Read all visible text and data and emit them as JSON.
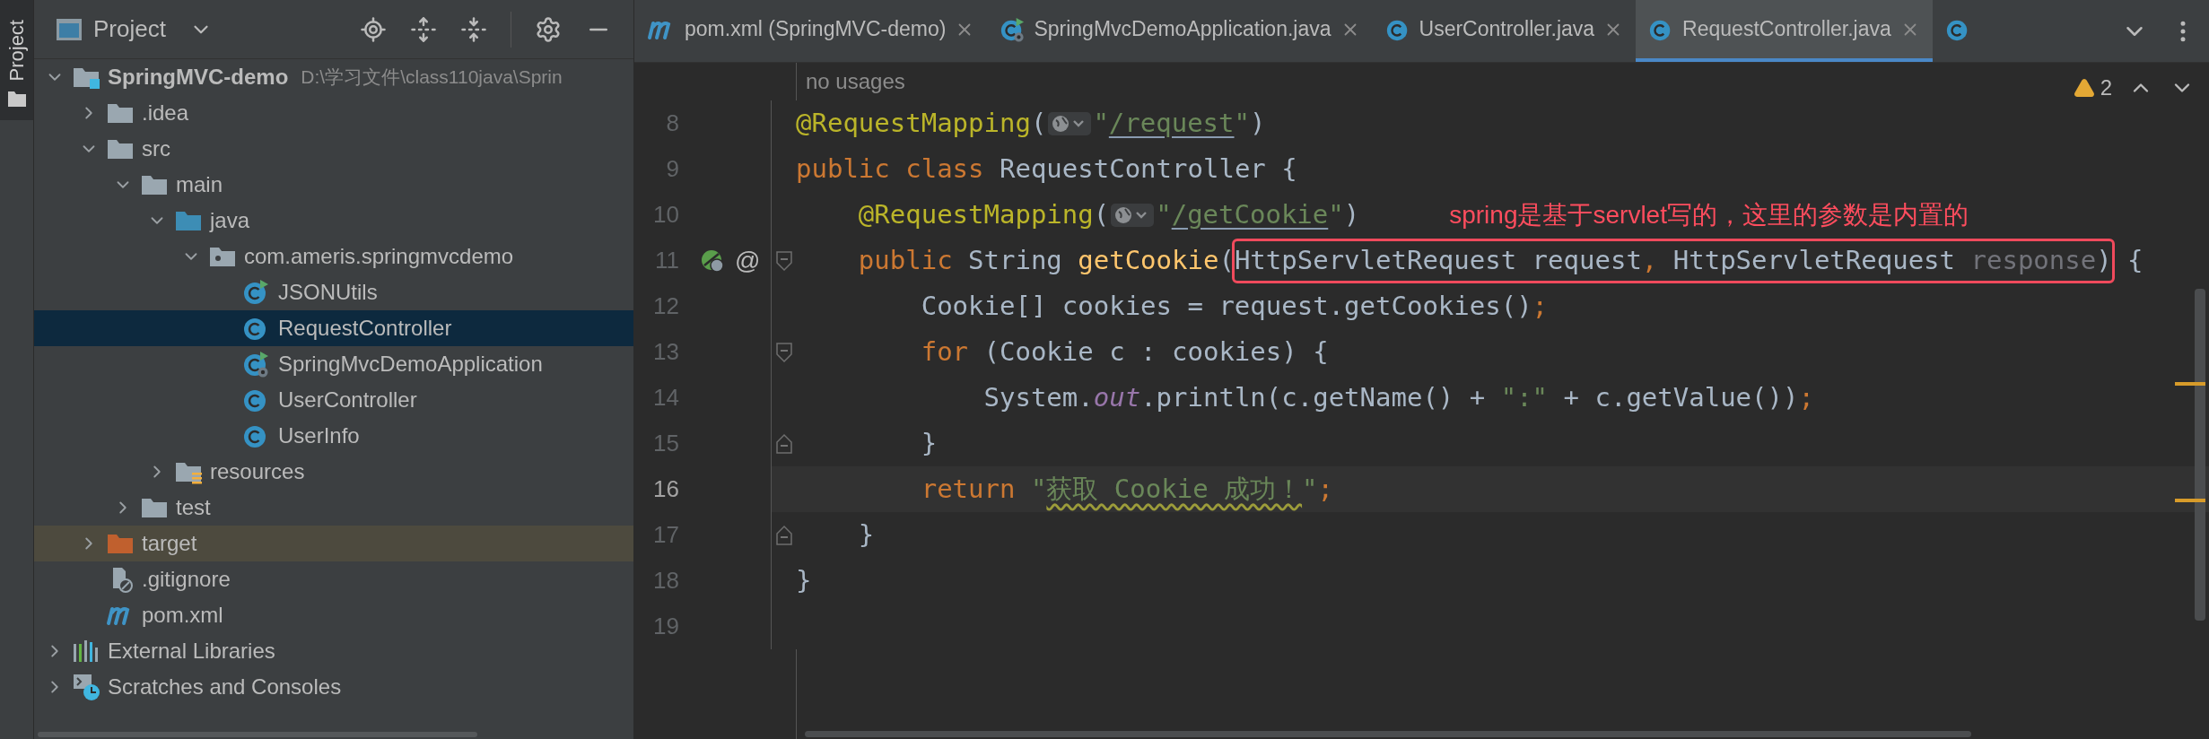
{
  "side_strip": {
    "label": "Project",
    "selected": true
  },
  "project_panel": {
    "title": "Project",
    "tree": [
      {
        "kind": "module",
        "label": "SpringMVC-demo",
        "path": "D:\\学习文件\\class110java\\Sprin",
        "expanded": true,
        "selected": false,
        "children": [
          {
            "kind": "folder",
            "label": ".idea",
            "expanded": false,
            "selected": false
          },
          {
            "kind": "folder",
            "label": "src",
            "expanded": true,
            "selected": false,
            "children": [
              {
                "kind": "folder",
                "label": "main",
                "expanded": true,
                "selected": false,
                "children": [
                  {
                    "kind": "source-folder",
                    "label": "java",
                    "expanded": true,
                    "selected": false,
                    "children": [
                      {
                        "kind": "package",
                        "label": "com.ameris.springmvcdemo",
                        "expanded": true,
                        "selected": false,
                        "children": [
                          {
                            "kind": "class-run",
                            "label": "JSONUtils",
                            "selected": false
                          },
                          {
                            "kind": "class",
                            "label": "RequestController",
                            "selected": true
                          },
                          {
                            "kind": "spring-app",
                            "label": "SpringMvcDemoApplication",
                            "selected": false
                          },
                          {
                            "kind": "class",
                            "label": "UserController",
                            "selected": false
                          },
                          {
                            "kind": "class",
                            "label": "UserInfo",
                            "selected": false
                          }
                        ]
                      }
                    ]
                  },
                  {
                    "kind": "resources-folder",
                    "label": "resources",
                    "expanded": false,
                    "selected": false
                  }
                ]
              },
              {
                "kind": "folder",
                "label": "test",
                "expanded": false,
                "selected": false
              }
            ]
          },
          {
            "kind": "excluded-folder",
            "label": "target",
            "expanded": false,
            "selected": false
          },
          {
            "kind": "gitignore",
            "label": ".gitignore",
            "selected": false
          },
          {
            "kind": "maven",
            "label": "pom.xml",
            "selected": false
          }
        ]
      },
      {
        "kind": "libraries",
        "label": "External Libraries",
        "expanded": false,
        "selected": false
      },
      {
        "kind": "scratches",
        "label": "Scratches and Consoles",
        "expanded": false,
        "selected": false
      }
    ]
  },
  "tabs": [
    {
      "kind": "maven",
      "label": "pom.xml (SpringMVC-demo)",
      "selected": false
    },
    {
      "kind": "spring-app",
      "label": "SpringMvcDemoApplication.java",
      "selected": false
    },
    {
      "kind": "class",
      "label": "UserController.java",
      "selected": false
    },
    {
      "kind": "class",
      "label": "RequestController.java",
      "selected": true
    },
    {
      "kind": "class",
      "selected": false
    }
  ],
  "editor": {
    "warnings": "2",
    "lines": [
      {
        "kind": "inlay",
        "inlay": "no usages"
      },
      {
        "number": "8",
        "tokens": [
          {
            "kind": "annotation",
            "text": "@RequestMapping"
          },
          {
            "kind": "plain",
            "text": "("
          },
          {
            "kind": "hint"
          },
          {
            "kind": "string",
            "text": "\""
          },
          {
            "kind": "url",
            "text": "/request"
          },
          {
            "kind": "string",
            "text": "\""
          },
          {
            "kind": "plain",
            "text": ")"
          }
        ]
      },
      {
        "number": "9",
        "tokens": [
          {
            "kind": "keyword",
            "text": "public class "
          },
          {
            "kind": "plain",
            "text": "RequestController {"
          }
        ]
      },
      {
        "number": "10",
        "tokens": [
          {
            "kind": "annotation",
            "text": "    @RequestMapping"
          },
          {
            "kind": "plain",
            "text": "("
          },
          {
            "kind": "hint"
          },
          {
            "kind": "string",
            "text": "\""
          },
          {
            "kind": "url",
            "text": "/getCookie"
          },
          {
            "kind": "string",
            "text": "\""
          },
          {
            "kind": "plain",
            "text": ")"
          }
        ],
        "note": "spring是基于servlet写的，这里的参数是内置的"
      },
      {
        "kind": "fold-start",
        "number": "11",
        "gutter": "@",
        "tokens": [
          {
            "kind": "keyword",
            "text": "    public "
          },
          {
            "kind": "plain",
            "text": "String "
          },
          {
            "kind": "method",
            "text": "getCookie"
          },
          {
            "kind": "plain",
            "text": "("
          }
        ],
        "boxed": [
          {
            "kind": "plain",
            "text": "HttpServletRequest request"
          },
          {
            "kind": "keyword",
            "text": ", "
          },
          {
            "kind": "plain",
            "text": "HttpServletRequest "
          },
          {
            "kind": "unused",
            "text": "response"
          },
          {
            "kind": "plain",
            "text": ")"
          }
        ],
        "tail": [
          {
            "kind": "plain",
            "text": " {"
          }
        ]
      },
      {
        "number": "12",
        "tokens": [
          {
            "kind": "plain",
            "text": "        Cookie[] cookies = request.getCookies()"
          },
          {
            "kind": "keyword",
            "text": ";"
          }
        ]
      },
      {
        "kind": "fold-start",
        "number": "13",
        "tokens": [
          {
            "kind": "keyword",
            "text": "        for "
          },
          {
            "kind": "plain",
            "text": "(Cookie c : cookies) {"
          }
        ]
      },
      {
        "number": "14",
        "tokens": [
          {
            "kind": "plain",
            "text": "            System."
          },
          {
            "kind": "static",
            "text": "out"
          },
          {
            "kind": "plain",
            "text": ".println(c.getName() + "
          },
          {
            "kind": "string",
            "text": "\":\""
          },
          {
            "kind": "plain",
            "text": " + c.getValue())"
          },
          {
            "kind": "keyword",
            "text": ";"
          }
        ]
      },
      {
        "kind": "fold-end",
        "number": "15",
        "tokens": [
          {
            "kind": "plain",
            "text": "        }"
          }
        ]
      },
      {
        "number": "16",
        "current": true,
        "tokens": [
          {
            "kind": "keyword",
            "text": "        return "
          },
          {
            "kind": "string",
            "text": "\""
          },
          {
            "kind": "typo",
            "text": "获取 Cookie 成功！"
          },
          {
            "kind": "string",
            "text": "\""
          },
          {
            "kind": "keyword",
            "text": ";"
          }
        ]
      },
      {
        "kind": "fold-end",
        "number": "17",
        "tokens": [
          {
            "kind": "plain",
            "text": "    }"
          }
        ]
      },
      {
        "number": "18",
        "tokens": [
          {
            "kind": "plain",
            "text": "}"
          }
        ]
      },
      {
        "number": "19"
      }
    ]
  }
}
